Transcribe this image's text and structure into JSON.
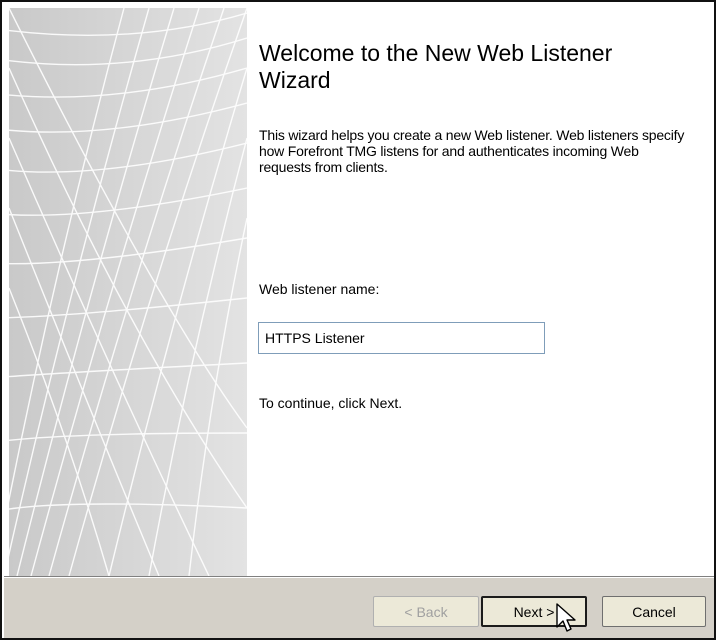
{
  "wizard": {
    "title": "Welcome to the New Web Listener Wizard",
    "description": "This wizard helps you create a new Web listener. Web listeners specify how Forefront TMG listens for and authenticates incoming Web requests from clients.",
    "name_label": "Web listener name:",
    "name_value": "HTTPS Listener",
    "hint": "To continue, click Next."
  },
  "buttons": {
    "back": "< Back",
    "next": "Next >",
    "cancel": "Cancel"
  },
  "colors": {
    "footer": "#d4d0c8",
    "side_panel": "#d6d6d6"
  },
  "icons": {
    "cursor": "arrow-cursor-icon",
    "side_art": "decorative-wave-graphic"
  }
}
